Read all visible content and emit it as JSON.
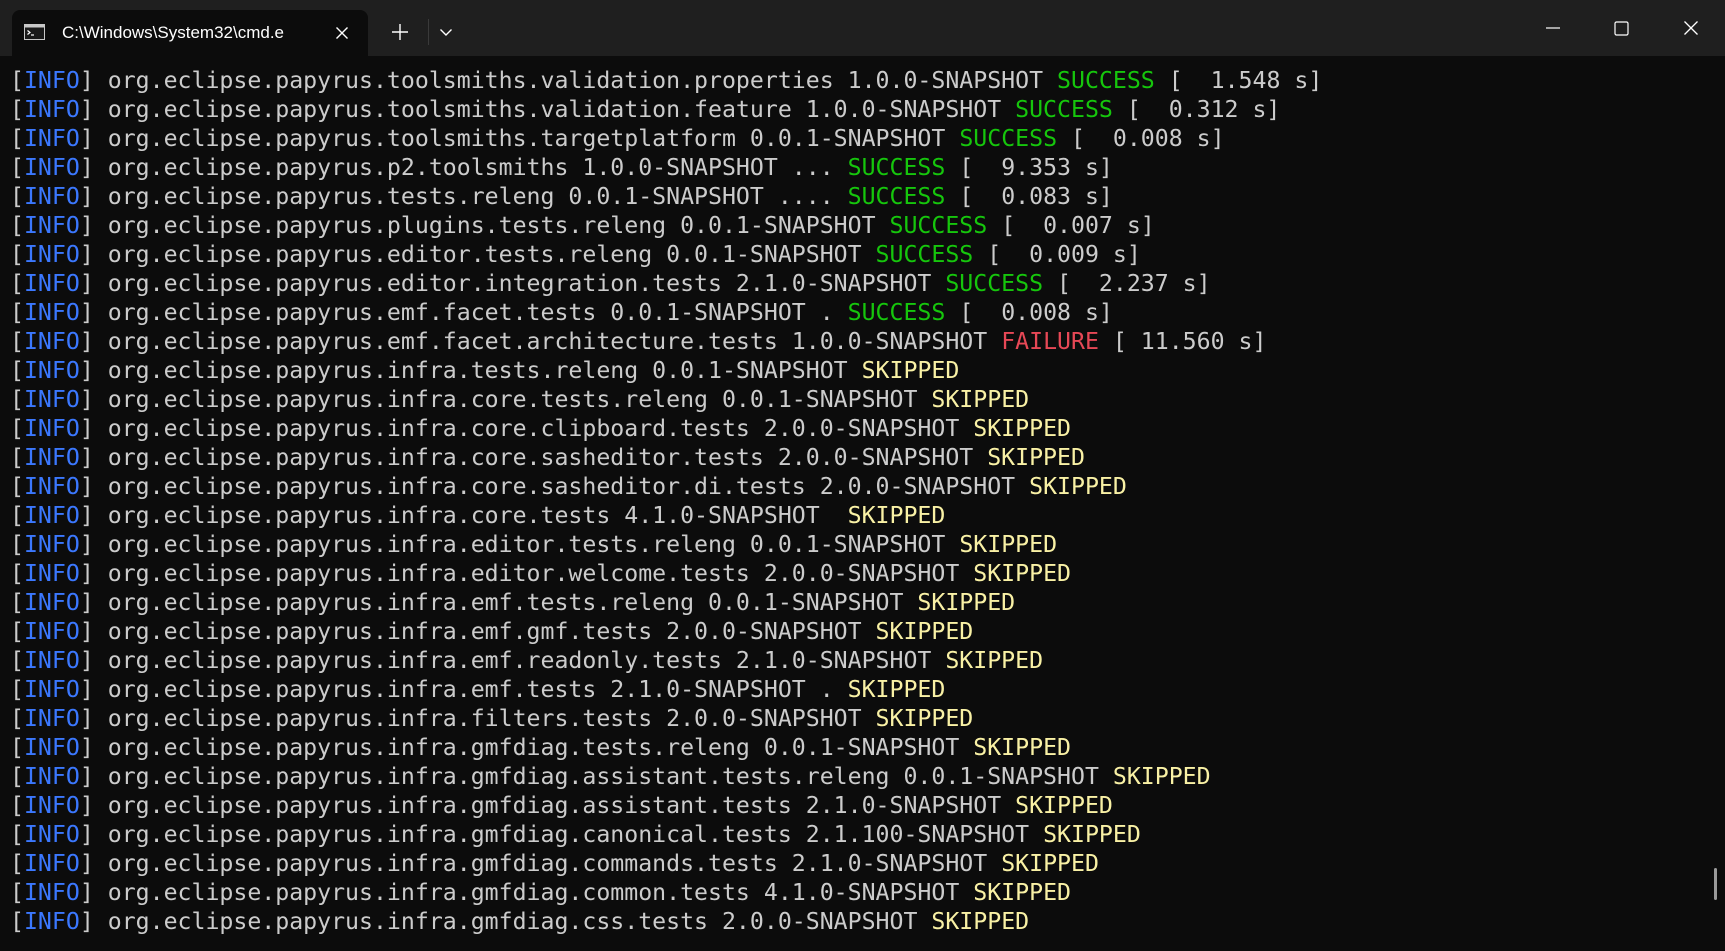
{
  "window": {
    "tab_title": "C:\\Windows\\System32\\cmd.e",
    "tab_icon": "terminal-icon"
  },
  "colors": {
    "info": "#3b78ff",
    "success": "#16c60c",
    "failure": "#e74856",
    "skipped": "#f9f1a5",
    "text": "#cccccc",
    "background": "#0c0c0c"
  },
  "log_lines": [
    {
      "level": "INFO",
      "module": "org.eclipse.papyrus.toolsmiths.validation.properties 1.0.0-SNAPSHOT ",
      "status": "SUCCESS",
      "status_class": "success",
      "time": " [  1.548 s]"
    },
    {
      "level": "INFO",
      "module": "org.eclipse.papyrus.toolsmiths.validation.feature 1.0.0-SNAPSHOT ",
      "status": "SUCCESS",
      "status_class": "success",
      "time": " [  0.312 s]"
    },
    {
      "level": "INFO",
      "module": "org.eclipse.papyrus.toolsmiths.targetplatform 0.0.1-SNAPSHOT ",
      "status": "SUCCESS",
      "status_class": "success",
      "time": " [  0.008 s]"
    },
    {
      "level": "INFO",
      "module": "org.eclipse.papyrus.p2.toolsmiths 1.0.0-SNAPSHOT ... ",
      "status": "SUCCESS",
      "status_class": "success",
      "time": " [  9.353 s]"
    },
    {
      "level": "INFO",
      "module": "org.eclipse.papyrus.tests.releng 0.0.1-SNAPSHOT .... ",
      "status": "SUCCESS",
      "status_class": "success",
      "time": " [  0.083 s]"
    },
    {
      "level": "INFO",
      "module": "org.eclipse.papyrus.plugins.tests.releng 0.0.1-SNAPSHOT ",
      "status": "SUCCESS",
      "status_class": "success",
      "time": " [  0.007 s]"
    },
    {
      "level": "INFO",
      "module": "org.eclipse.papyrus.editor.tests.releng 0.0.1-SNAPSHOT ",
      "status": "SUCCESS",
      "status_class": "success",
      "time": " [  0.009 s]"
    },
    {
      "level": "INFO",
      "module": "org.eclipse.papyrus.editor.integration.tests 2.1.0-SNAPSHOT ",
      "status": "SUCCESS",
      "status_class": "success",
      "time": " [  2.237 s]"
    },
    {
      "level": "INFO",
      "module": "org.eclipse.papyrus.emf.facet.tests 0.0.1-SNAPSHOT . ",
      "status": "SUCCESS",
      "status_class": "success",
      "time": " [  0.008 s]"
    },
    {
      "level": "INFO",
      "module": "org.eclipse.papyrus.emf.facet.architecture.tests 1.0.0-SNAPSHOT ",
      "status": "FAILURE",
      "status_class": "failure",
      "time": " [ 11.560 s]"
    },
    {
      "level": "INFO",
      "module": "org.eclipse.papyrus.infra.tests.releng 0.0.1-SNAPSHOT ",
      "status": "SKIPPED",
      "status_class": "skipped",
      "time": ""
    },
    {
      "level": "INFO",
      "module": "org.eclipse.papyrus.infra.core.tests.releng 0.0.1-SNAPSHOT ",
      "status": "SKIPPED",
      "status_class": "skipped",
      "time": ""
    },
    {
      "level": "INFO",
      "module": "org.eclipse.papyrus.infra.core.clipboard.tests 2.0.0-SNAPSHOT ",
      "status": "SKIPPED",
      "status_class": "skipped",
      "time": ""
    },
    {
      "level": "INFO",
      "module": "org.eclipse.papyrus.infra.core.sasheditor.tests 2.0.0-SNAPSHOT ",
      "status": "SKIPPED",
      "status_class": "skipped",
      "time": ""
    },
    {
      "level": "INFO",
      "module": "org.eclipse.papyrus.infra.core.sasheditor.di.tests 2.0.0-SNAPSHOT ",
      "status": "SKIPPED",
      "status_class": "skipped",
      "time": ""
    },
    {
      "level": "INFO",
      "module": "org.eclipse.papyrus.infra.core.tests 4.1.0-SNAPSHOT  ",
      "status": "SKIPPED",
      "status_class": "skipped",
      "time": ""
    },
    {
      "level": "INFO",
      "module": "org.eclipse.papyrus.infra.editor.tests.releng 0.0.1-SNAPSHOT ",
      "status": "SKIPPED",
      "status_class": "skipped",
      "time": ""
    },
    {
      "level": "INFO",
      "module": "org.eclipse.papyrus.infra.editor.welcome.tests 2.0.0-SNAPSHOT ",
      "status": "SKIPPED",
      "status_class": "skipped",
      "time": ""
    },
    {
      "level": "INFO",
      "module": "org.eclipse.papyrus.infra.emf.tests.releng 0.0.1-SNAPSHOT ",
      "status": "SKIPPED",
      "status_class": "skipped",
      "time": ""
    },
    {
      "level": "INFO",
      "module": "org.eclipse.papyrus.infra.emf.gmf.tests 2.0.0-SNAPSHOT ",
      "status": "SKIPPED",
      "status_class": "skipped",
      "time": ""
    },
    {
      "level": "INFO",
      "module": "org.eclipse.papyrus.infra.emf.readonly.tests 2.1.0-SNAPSHOT ",
      "status": "SKIPPED",
      "status_class": "skipped",
      "time": ""
    },
    {
      "level": "INFO",
      "module": "org.eclipse.papyrus.infra.emf.tests 2.1.0-SNAPSHOT . ",
      "status": "SKIPPED",
      "status_class": "skipped",
      "time": ""
    },
    {
      "level": "INFO",
      "module": "org.eclipse.papyrus.infra.filters.tests 2.0.0-SNAPSHOT ",
      "status": "SKIPPED",
      "status_class": "skipped",
      "time": ""
    },
    {
      "level": "INFO",
      "module": "org.eclipse.papyrus.infra.gmfdiag.tests.releng 0.0.1-SNAPSHOT ",
      "status": "SKIPPED",
      "status_class": "skipped",
      "time": ""
    },
    {
      "level": "INFO",
      "module": "org.eclipse.papyrus.infra.gmfdiag.assistant.tests.releng 0.0.1-SNAPSHOT ",
      "status": "SKIPPED",
      "status_class": "skipped",
      "time": ""
    },
    {
      "level": "INFO",
      "module": "org.eclipse.papyrus.infra.gmfdiag.assistant.tests 2.1.0-SNAPSHOT ",
      "status": "SKIPPED",
      "status_class": "skipped",
      "time": ""
    },
    {
      "level": "INFO",
      "module": "org.eclipse.papyrus.infra.gmfdiag.canonical.tests 2.1.100-SNAPSHOT ",
      "status": "SKIPPED",
      "status_class": "skipped",
      "time": ""
    },
    {
      "level": "INFO",
      "module": "org.eclipse.papyrus.infra.gmfdiag.commands.tests 2.1.0-SNAPSHOT ",
      "status": "SKIPPED",
      "status_class": "skipped",
      "time": ""
    },
    {
      "level": "INFO",
      "module": "org.eclipse.papyrus.infra.gmfdiag.common.tests 4.1.0-SNAPSHOT ",
      "status": "SKIPPED",
      "status_class": "skipped",
      "time": ""
    },
    {
      "level": "INFO",
      "module": "org.eclipse.papyrus.infra.gmfdiag.css.tests 2.0.0-SNAPSHOT ",
      "status": "SKIPPED",
      "status_class": "skipped",
      "time": ""
    }
  ]
}
